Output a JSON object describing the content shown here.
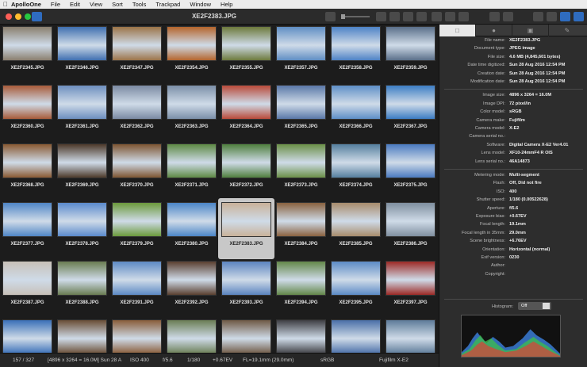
{
  "menubar": {
    "app": "ApolloOne",
    "items": [
      "File",
      "Edit",
      "View",
      "Sort",
      "Tools",
      "Trackpad",
      "Window",
      "Help"
    ]
  },
  "window": {
    "title": "XE2F2383.JPG"
  },
  "thumbnails": [
    [
      "XE2F2345.JPG",
      "XE2F2346.JPG",
      "XE2F2347.JPG",
      "XE2F2354.JPG",
      "XE2F2355.JPG",
      "XE2F2357.JPG",
      "XE2F2358.JPG",
      "XE2F2359.JPG"
    ],
    [
      "XE2F2360.JPG",
      "XE2F2361.JPG",
      "XE2F2362.JPG",
      "XE2F2363.JPG",
      "XE2F2364.JPG",
      "XE2F2365.JPG",
      "XE2F2366.JPG",
      "XE2F2367.JPG"
    ],
    [
      "XE2F2368.JPG",
      "XE2F2369.JPG",
      "XE2F2370.JPG",
      "XE2F2371.JPG",
      "XE2F2372.JPG",
      "XE2F2373.JPG",
      "XE2F2374.JPG",
      "XE2F2375.JPG"
    ],
    [
      "XE2F2377.JPG",
      "XE2F2378.JPG",
      "XE2F2379.JPG",
      "XE2F2380.JPG",
      "XE2F2383.JPG",
      "XE2F2384.JPG",
      "XE2F2385.JPG",
      "XE2F2386.JPG"
    ],
    [
      "XE2F2387.JPG",
      "XE2F2388.JPG",
      "XE2F2391.JPG",
      "XE2F2392.JPG",
      "XE2F2393.JPG",
      "XE2F2394.JPG",
      "XE2F2395.JPG",
      "XE2F2397.JPG"
    ],
    [
      "",
      "",
      "",
      "",
      "",
      "",
      "",
      ""
    ]
  ],
  "selected_file": "XE2F2383.JPG",
  "statusbar": {
    "count": "157 / 327",
    "dimensions": "[4896 x 3264 = 16.0M] Sun 28 A",
    "iso": "ISO 400",
    "aperture": "f/5.6",
    "shutter": "1/180",
    "exposure": "+0.67EV",
    "focal": "FL=19.1mm (29.0mm)",
    "colorspace": "sRGB",
    "camera": "Fujifilm X-E2"
  },
  "info_panel": {
    "section1": [
      {
        "key": "File name:",
        "value": "XE2F2383.JPG"
      },
      {
        "key": "Document type:",
        "value": "JPEG image"
      },
      {
        "key": "File size:",
        "value": "4.6 MB (4,845,601 bytes)"
      },
      {
        "key": "Date time digitized:",
        "value": "Sun 28 Aug 2016  12:54 PM"
      },
      {
        "key": "Creation date:",
        "value": "Sun 28 Aug 2016  12:54 PM"
      },
      {
        "key": "Modification date:",
        "value": "Sun 28 Aug 2016  12:54 PM"
      }
    ],
    "section2": [
      {
        "key": "Image size:",
        "value": "4896 x 3264 = 16.0M"
      },
      {
        "key": "Image DPI:",
        "value": "72 pixel/in"
      },
      {
        "key": "Color model:",
        "value": "sRGB"
      },
      {
        "key": "Camera make:",
        "value": "Fujifilm"
      },
      {
        "key": "Camera model:",
        "value": "X-E2"
      },
      {
        "key": "Camera serial no.:",
        "value": ""
      },
      {
        "key": "Software:",
        "value": "Digital Camera X-E2 Ver4.01"
      },
      {
        "key": "Lens model:",
        "value": "XF10-24mmF4 R OIS"
      },
      {
        "key": "Lens serial no.:",
        "value": "46A14873"
      }
    ],
    "section3": [
      {
        "key": "Metering mode:",
        "value": "Multi-segment"
      },
      {
        "key": "Flash:",
        "value": "Off, Did not fire"
      },
      {
        "key": "ISO:",
        "value": "400"
      },
      {
        "key": "Shutter speed:",
        "value": "1/180 (0.00522628)"
      },
      {
        "key": "Aperture:",
        "value": "f/5.6"
      },
      {
        "key": "Exposure bias:",
        "value": "+0.67EV"
      },
      {
        "key": "Focal length:",
        "value": "19.1mm"
      },
      {
        "key": "Focal length in 35mm:",
        "value": "29.0mm"
      },
      {
        "key": "Scene brightness:",
        "value": "+6.76EV"
      },
      {
        "key": "Orientation:",
        "value": "Horizontal (normal)"
      },
      {
        "key": "Exif version:",
        "value": "0230"
      },
      {
        "key": "Author:",
        "value": ""
      },
      {
        "key": "Copyright:",
        "value": ""
      }
    ],
    "histogram_label": "Histogram:",
    "histogram_toggle": "Off"
  },
  "thumb_colors": [
    [
      "#8a7f6e",
      "#3f6fb0",
      "#9c7448",
      "#b5652c",
      "#6d7a3c",
      "#5f8ec4",
      "#4d82c6",
      "#5a6f8a"
    ],
    [
      "#a85b3a",
      "#6d8fbf",
      "#7b8aa3",
      "#7b8fa8",
      "#b94a3a",
      "#5a78a8",
      "#5e8fc7",
      "#3c7dc4"
    ],
    [
      "#8a5a33",
      "#4d3a2a",
      "#7e5532",
      "#5e8a45",
      "#4f7f3e",
      "#6b9048",
      "#557f9e",
      "#4a7ac0"
    ],
    [
      "#4f86c6",
      "#5a8acc",
      "#6c9a3c",
      "#4b86c8",
      "#c9b29a",
      "#8a6240",
      "#a88c6c",
      "#7f8f9f"
    ],
    [
      "#c7c0b8",
      "#6a7d52",
      "#5d8ac4",
      "#5a4030",
      "#5b84bf",
      "#63884a",
      "#5c8bc6",
      "#9c2a26"
    ],
    [
      "#3a70b8",
      "#6a4e36",
      "#8a5d3a",
      "#6b7e55",
      "#705a46",
      "#3f3f44",
      "#4a6fa8",
      "#5e7c9a"
    ]
  ],
  "colors": {
    "selected_bg": "#c8c8c8",
    "accent": "#2f6cbf"
  }
}
